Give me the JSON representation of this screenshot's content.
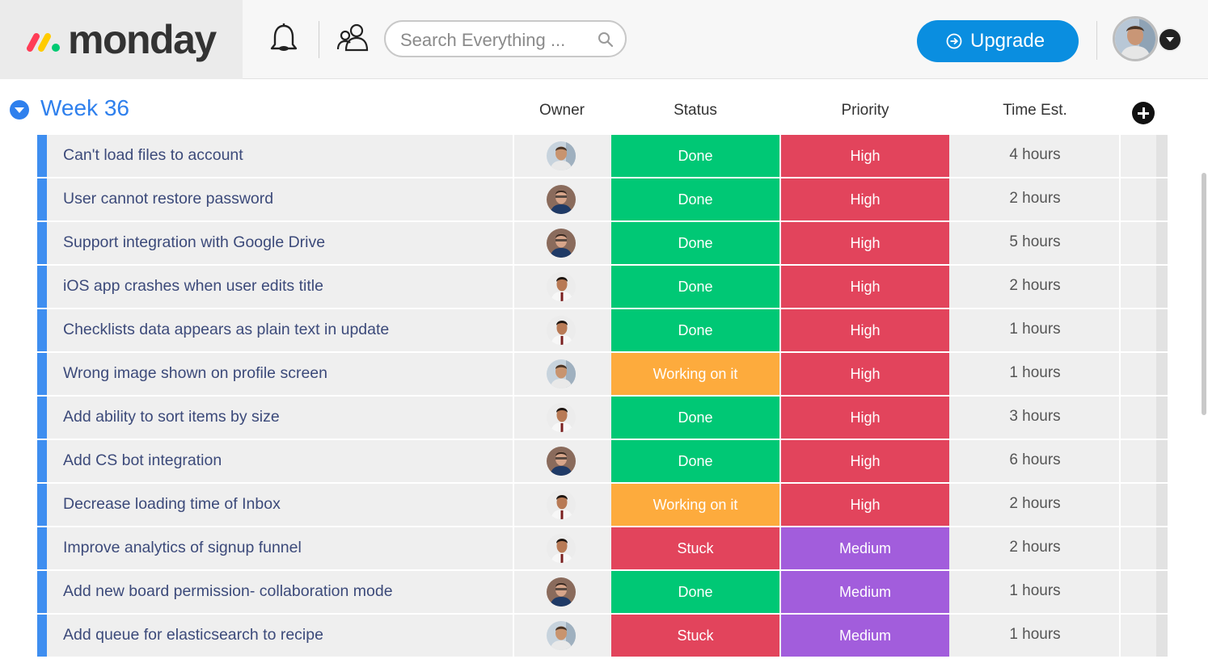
{
  "app": {
    "logo_text": "monday",
    "search_placeholder": "Search Everything ...",
    "upgrade_label": "Upgrade"
  },
  "group": {
    "title": "Week 36",
    "columns": [
      "Owner",
      "Status",
      "Priority",
      "Time Est."
    ]
  },
  "colors": {
    "accent": "#2f80ed",
    "row_accent": "#3e8ef0",
    "done": "#00c875",
    "working": "#fdab3d",
    "stuck": "#e2445c",
    "high": "#e2445c",
    "medium": "#a25ddc",
    "upgrade": "#0a8ee0"
  },
  "rows": [
    {
      "name": "Can't load files to account",
      "owner": "avatar-a",
      "status": "Done",
      "priority": "High",
      "time": "4 hours"
    },
    {
      "name": "User cannot restore password",
      "owner": "avatar-b",
      "status": "Done",
      "priority": "High",
      "time": "2 hours"
    },
    {
      "name": "Support integration with Google Drive",
      "owner": "avatar-b",
      "status": "Done",
      "priority": "High",
      "time": "5 hours"
    },
    {
      "name": "iOS app crashes when user edits title",
      "owner": "avatar-c",
      "status": "Done",
      "priority": "High",
      "time": "2 hours"
    },
    {
      "name": "Checklists data appears as plain text in update",
      "owner": "avatar-c",
      "status": "Done",
      "priority": "High",
      "time": "1 hours"
    },
    {
      "name": "Wrong image shown on profile screen",
      "owner": "avatar-a",
      "status": "Working on it",
      "priority": "High",
      "time": "1 hours"
    },
    {
      "name": "Add ability to sort items by size",
      "owner": "avatar-c",
      "status": "Done",
      "priority": "High",
      "time": "3 hours"
    },
    {
      "name": "Add CS bot integration",
      "owner": "avatar-b",
      "status": "Done",
      "priority": "High",
      "time": "6 hours"
    },
    {
      "name": "Decrease loading time of Inbox",
      "owner": "avatar-c",
      "status": "Working on it",
      "priority": "High",
      "time": "2 hours"
    },
    {
      "name": "Improve analytics of signup funnel",
      "owner": "avatar-c",
      "status": "Stuck",
      "priority": "Medium",
      "time": "2 hours"
    },
    {
      "name": "Add new board permission- collaboration mode",
      "owner": "avatar-b",
      "status": "Done",
      "priority": "Medium",
      "time": "1 hours"
    },
    {
      "name": "Add queue for elasticsearch to recipe",
      "owner": "avatar-a",
      "status": "Stuck",
      "priority": "Medium",
      "time": "1 hours"
    }
  ]
}
